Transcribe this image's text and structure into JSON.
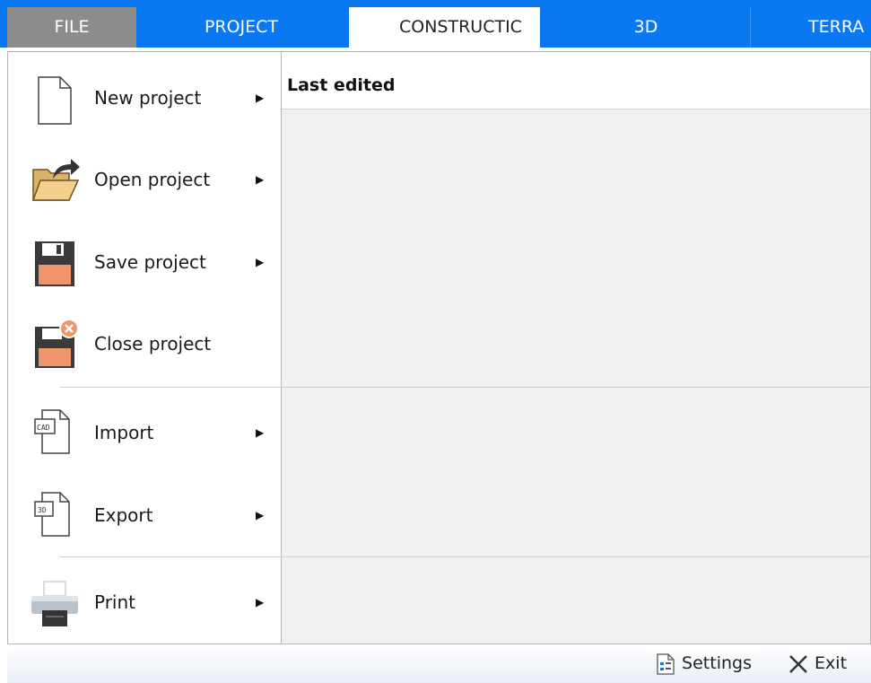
{
  "tabs": [
    {
      "label": "FILE"
    },
    {
      "label": "PROJECT"
    },
    {
      "label": "CONSTRUCTIC"
    },
    {
      "label": "3D"
    },
    {
      "label": "TERRA"
    }
  ],
  "menu": {
    "items": [
      {
        "label": "New project",
        "icon": "new-document-icon",
        "has_submenu": true
      },
      {
        "label": "Open project",
        "icon": "open-folder-icon",
        "has_submenu": true
      },
      {
        "label": "Save project",
        "icon": "save-icon",
        "has_submenu": true
      },
      {
        "label": "Close project",
        "icon": "close-save-icon",
        "has_submenu": false
      },
      {
        "label": "Import",
        "icon": "cad-document-icon",
        "has_submenu": true
      },
      {
        "label": "Export",
        "icon": "3d-document-icon",
        "has_submenu": true
      },
      {
        "label": "Print",
        "icon": "printer-icon",
        "has_submenu": true
      }
    ],
    "submenu_arrow": "▶"
  },
  "content": {
    "header": "Last edited"
  },
  "footer": {
    "settings_label": "Settings",
    "exit_label": "Exit"
  },
  "colors": {
    "tab_bar": "#0a78f0",
    "file_tab": "#8c8c8c",
    "content_bg": "#f0f0f0",
    "save_icon_accent": "#f0956a"
  }
}
